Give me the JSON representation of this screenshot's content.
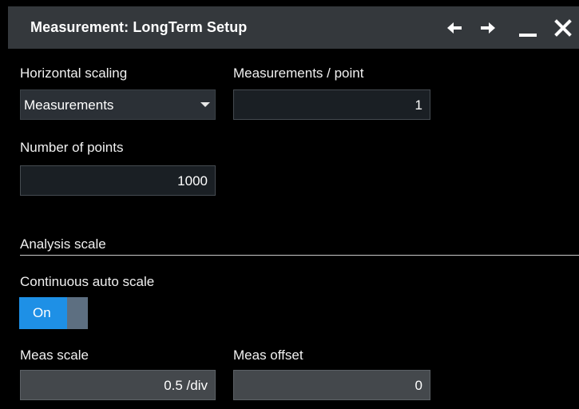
{
  "window": {
    "title": "Measurement: LongTerm Setup",
    "icons": [
      "arrow-left-icon",
      "arrow-right-icon",
      "minimize-icon",
      "close-icon"
    ]
  },
  "horizontal_scaling": {
    "label": "Horizontal scaling",
    "selected": "Measurements"
  },
  "measurements_per_point": {
    "label": "Measurements / point",
    "value": "1"
  },
  "number_of_points": {
    "label": "Number of points",
    "value": "1000"
  },
  "analysis_scale": {
    "section_title": "Analysis scale",
    "continuous_auto_scale": {
      "label": "Continuous auto scale",
      "state": "On"
    },
    "meas_scale": {
      "label": "Meas scale",
      "value": "0.5 /div"
    },
    "meas_offset": {
      "label": "Meas offset",
      "value": "0"
    }
  },
  "colors": {
    "background": "#000000",
    "titlebar": "#34383c",
    "toggle_on": "#1e90e6",
    "toggle_knob": "#5d6f81"
  }
}
